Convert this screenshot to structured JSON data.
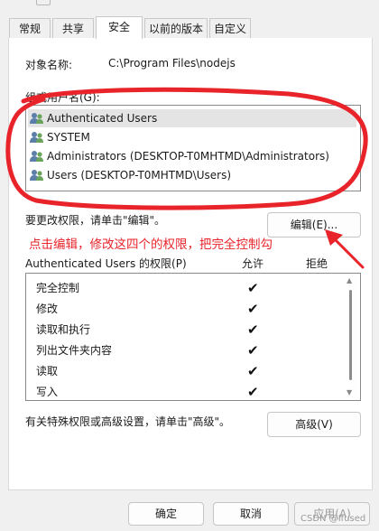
{
  "tabs": [
    {
      "label": "常规"
    },
    {
      "label": "共享"
    },
    {
      "label": "安全"
    },
    {
      "label": "以前的版本"
    },
    {
      "label": "自定义"
    }
  ],
  "active_tab": "安全",
  "object": {
    "label": "对象名称:",
    "value": "C:\\Program Files\\nodejs"
  },
  "groups": {
    "label": "组或用户名(G):",
    "items": [
      {
        "label": "Authenticated Users"
      },
      {
        "label": "SYSTEM"
      },
      {
        "label": "Administrators (DESKTOP-T0MHTMD\\Administrators)"
      },
      {
        "label": "Users (DESKTOP-T0MHTMD\\Users)"
      }
    ],
    "selected_index": 0
  },
  "change_hint": "要更改权限，请单击\"编辑\"。",
  "edit_button": "编辑(E)...",
  "annotation": "点击编辑，修改这四个的权限，把完全控制勾",
  "permissions": {
    "title": "Authenticated Users 的权限(P)",
    "allow_label": "允许",
    "deny_label": "拒绝",
    "check_glyph": "✔",
    "items": [
      {
        "name": "完全控制",
        "allow": true,
        "deny": false
      },
      {
        "name": "修改",
        "allow": true,
        "deny": false
      },
      {
        "name": "读取和执行",
        "allow": true,
        "deny": false
      },
      {
        "name": "列出文件夹内容",
        "allow": true,
        "deny": false
      },
      {
        "name": "读取",
        "allow": true,
        "deny": false
      },
      {
        "name": "写入",
        "allow": true,
        "deny": false
      }
    ]
  },
  "advanced_hint": "有关特殊权限或高级设置，请单击\"高级\"。",
  "advanced_button": "高级(V)",
  "footer": {
    "ok": "确定",
    "cancel": "取消",
    "apply": "应用(A)"
  },
  "watermark": "CSDN @Ifused",
  "colors": {
    "annotation": "#e8242a",
    "panel": "#ffffff",
    "dialog": "#f0f0f0"
  }
}
